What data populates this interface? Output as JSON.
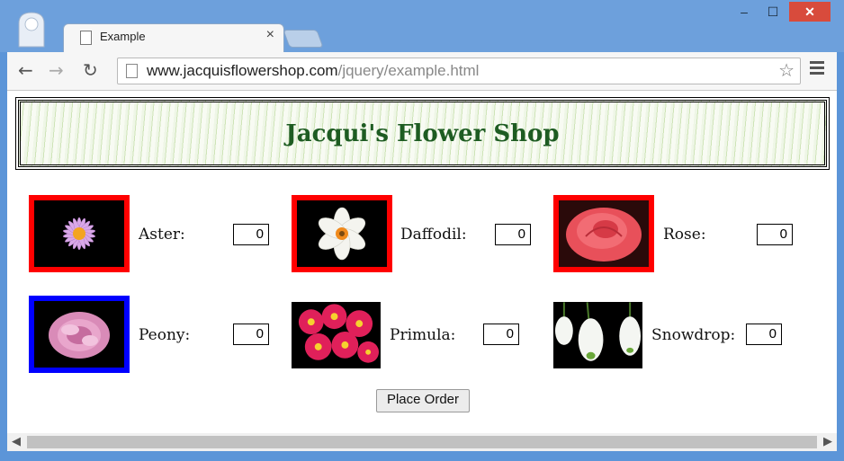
{
  "browser": {
    "tab_title": "Example",
    "tab_close": "×",
    "url_host": "www.jacquisflowershop.com",
    "url_path": "/jquery/example.html",
    "back": "←",
    "forward": "→",
    "reload": "↻",
    "star": "☆",
    "window_min": "‒",
    "window_max": "☐",
    "window_close": "✕"
  },
  "page": {
    "title": "Jacqui's Flower Shop",
    "order_button": "Place Order"
  },
  "products": [
    {
      "name": "Aster:",
      "qty": "0",
      "border": "red",
      "icon": "aster-flower-image"
    },
    {
      "name": "Daffodil:",
      "qty": "0",
      "border": "red",
      "icon": "daffodil-flower-image"
    },
    {
      "name": "Rose:",
      "qty": "0",
      "border": "red",
      "icon": "rose-flower-image"
    },
    {
      "name": "Peony:",
      "qty": "0",
      "border": "blue",
      "icon": "peony-flower-image"
    },
    {
      "name": "Primula:",
      "qty": "0",
      "border": "none",
      "icon": "primula-flower-image"
    },
    {
      "name": "Snowdrop:",
      "qty": "0",
      "border": "none",
      "icon": "snowdrop-flower-image"
    }
  ],
  "colors": {
    "title_green": "#1e5c22",
    "border_red": "#ff0000",
    "border_blue": "#0000ff",
    "window_frame": "#6da0dc"
  }
}
